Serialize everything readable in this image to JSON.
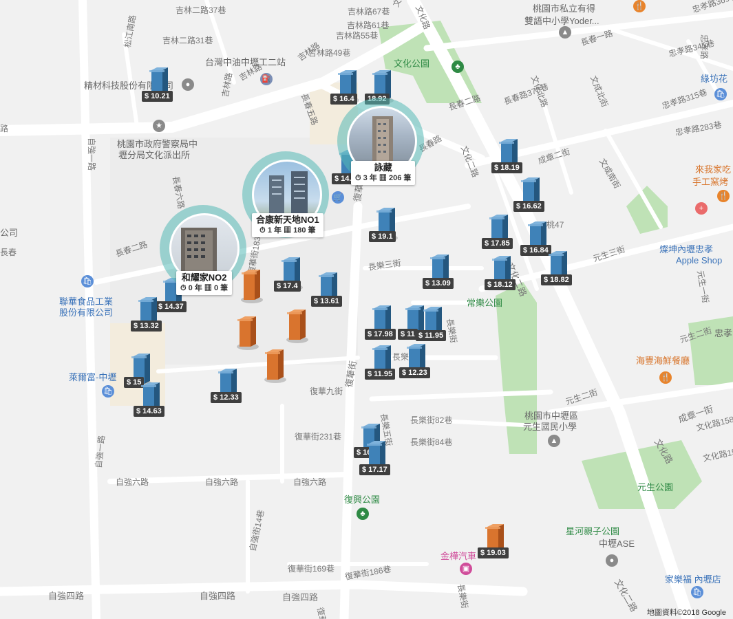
{
  "map": {
    "attribution": "地圖資料©2018 Google",
    "colors": {
      "background": "#f1f1f1",
      "road": "#ffffff",
      "park": "#bfe2b6",
      "building": "#e6e6e6",
      "pin_blue": "#3f82b8",
      "pin_orange": "#d9742e",
      "cluster_ring": "#56b9b6",
      "price_tag": "#3f3f3f"
    }
  },
  "labels": [
    {
      "text": "吉林二路37巷"
    },
    {
      "text": "吉林路67巷"
    },
    {
      "text": "吉林路61巷"
    },
    {
      "text": "吉林二路31巷"
    },
    {
      "text": "吉林路55巷"
    },
    {
      "text": "吉林路49巷"
    },
    {
      "text": "文化路"
    },
    {
      "text": "文化路"
    },
    {
      "text": "桃園市私立有得"
    },
    {
      "text": "雙語中小學Yoder..."
    },
    {
      "text": "忠孝路369巷"
    },
    {
      "text": "忠孝路"
    },
    {
      "text": "松江南路"
    },
    {
      "text": "台灣中油中壢工二站"
    },
    {
      "text": "文化公園"
    },
    {
      "text": "長春一路"
    },
    {
      "text": "忠孝路345巷"
    },
    {
      "text": "綠坊花"
    },
    {
      "text": "精材科技股份有限公司"
    },
    {
      "text": "吉林路"
    },
    {
      "text": "吉林路"
    },
    {
      "text": "吉林路"
    },
    {
      "text": "長春五路"
    },
    {
      "text": "長春二路"
    },
    {
      "text": "長春路378巷"
    },
    {
      "text": "文化北路"
    },
    {
      "text": "文成北街"
    },
    {
      "text": "忠孝路315巷"
    },
    {
      "text": "忠孝路283巷"
    },
    {
      "text": "路"
    },
    {
      "text": "自強一路"
    },
    {
      "text": "桃園市政府警察局中"
    },
    {
      "text": "壢分局文化派出所"
    },
    {
      "text": "長春路"
    },
    {
      "text": "文化二路"
    },
    {
      "text": "成章二街"
    },
    {
      "text": "文成南街"
    },
    {
      "text": "來我家吃"
    },
    {
      "text": "手工窯烤"
    },
    {
      "text": "長春六路"
    },
    {
      "text": "復華街"
    },
    {
      "text": "公司"
    },
    {
      "text": "長春二路"
    },
    {
      "text": "桃47"
    },
    {
      "text": "燦坤內壢忠孝"
    },
    {
      "text": "Apple Shop"
    },
    {
      "text": "長樂三街"
    },
    {
      "text": "元生三街"
    },
    {
      "text": "文化二路"
    },
    {
      "text": "元生一街"
    },
    {
      "text": "聯華食品工業"
    },
    {
      "text": "股份有限公司"
    },
    {
      "text": "復華街183巷"
    },
    {
      "text": "常樂公園"
    },
    {
      "text": "長樂街"
    },
    {
      "text": "元生二街"
    },
    {
      "text": "忠孝"
    },
    {
      "text": "海豐海鮮餐廳"
    },
    {
      "text": "萊爾富-中壢"
    },
    {
      "text": "復華九街"
    },
    {
      "text": "復華街"
    },
    {
      "text": "長樂七街"
    },
    {
      "text": "元生二街"
    },
    {
      "text": "桃園市中壢區"
    },
    {
      "text": "元生國民小學"
    },
    {
      "text": "成章一街"
    },
    {
      "text": "長樂街82巷"
    },
    {
      "text": "長樂五街"
    },
    {
      "text": "長樂街84巷"
    },
    {
      "text": "文化路158巷"
    },
    {
      "text": "文化路"
    },
    {
      "text": "復華街231巷"
    },
    {
      "text": "自強六路"
    },
    {
      "text": "自強六路"
    },
    {
      "text": "自強六路"
    },
    {
      "text": "自強一路"
    },
    {
      "text": "文化路158巷"
    },
    {
      "text": "復興公園"
    },
    {
      "text": "元生公園"
    },
    {
      "text": "星河親子公園"
    },
    {
      "text": "中壢ASE"
    },
    {
      "text": "金樺汽車"
    },
    {
      "text": "復華街169巷"
    },
    {
      "text": "復華街186巷"
    },
    {
      "text": "自強街14巷"
    },
    {
      "text": "長樂街"
    },
    {
      "text": "家樂福 內壢店"
    },
    {
      "text": "自強四路"
    },
    {
      "text": "自強四路"
    },
    {
      "text": "自強四路"
    },
    {
      "text": "復華街"
    },
    {
      "text": "文化二路"
    },
    {
      "text": "長春"
    }
  ],
  "price_pins": [
    {
      "price": "$ 10.21",
      "color": "blue"
    },
    {
      "price": "$ 16.4",
      "color": "blue"
    },
    {
      "price": "18.92",
      "color": "blue"
    },
    {
      "price": "$ 14.",
      "color": "blue"
    },
    {
      "price": "$ 18.19",
      "color": "blue"
    },
    {
      "price": "$ 16.62",
      "color": "blue"
    },
    {
      "price": "$ 19.1",
      "color": "blue"
    },
    {
      "price": "$ 17.85",
      "color": "blue"
    },
    {
      "price": "$ 16.84",
      "color": "blue"
    },
    {
      "price": "$ 18.82",
      "color": "blue"
    },
    {
      "price": "$ 18.12",
      "color": "blue"
    },
    {
      "price": "$ 13.09",
      "color": "blue"
    },
    {
      "price": "$ 17.4",
      "color": "blue"
    },
    {
      "price": "$ 13.61",
      "color": "blue"
    },
    {
      "price": "$ 14.37",
      "color": "blue"
    },
    {
      "price": "$ 13.32",
      "color": "blue"
    },
    {
      "price": "$ 17.98",
      "color": "blue"
    },
    {
      "price": "$ 11",
      "color": "blue"
    },
    {
      "price": "$ 11.95",
      "color": "blue"
    },
    {
      "price": "$ 11.95",
      "color": "blue"
    },
    {
      "price": "$ 12.23",
      "color": "blue"
    },
    {
      "price": "$ 15",
      "color": "blue"
    },
    {
      "price": "$ 14.63",
      "color": "blue"
    },
    {
      "price": "$ 12.33",
      "color": "blue"
    },
    {
      "price": "$ 16",
      "color": "blue"
    },
    {
      "price": "$ 17.17",
      "color": "blue"
    },
    {
      "price": "$ 19.03",
      "color": "orange"
    }
  ],
  "plain_pins": [
    {
      "color": "orange"
    },
    {
      "color": "orange"
    },
    {
      "color": "orange"
    },
    {
      "color": "orange"
    }
  ],
  "clusters": [
    {
      "name": "詠藏",
      "age": "3 年",
      "count": "206 筆"
    },
    {
      "name": "合康新天地NO1",
      "age": "1 年",
      "count": "180 筆"
    },
    {
      "name": "和耀家NO2",
      "age": "0 年",
      "count": "0 筆"
    }
  ]
}
